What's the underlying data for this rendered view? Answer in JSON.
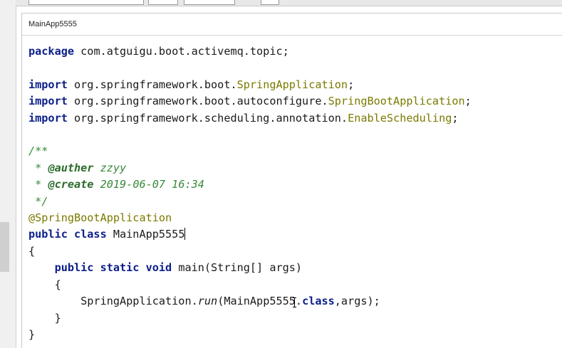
{
  "tab": {
    "title": "MainApp5555"
  },
  "code": {
    "package_kw": "package",
    "package_name": " com.atguigu.boot.activemq.topic;",
    "imports": [
      {
        "kw": "import",
        "path": " org.springframework.boot.",
        "cls": "SpringApplication",
        "end": ";"
      },
      {
        "kw": "import",
        "path": " org.springframework.boot.autoconfigure.",
        "cls": "SpringBootApplication",
        "end": ";"
      },
      {
        "kw": "import",
        "path": " org.springframework.scheduling.annotation.",
        "cls": "EnableScheduling",
        "end": ";"
      }
    ],
    "comment_open": "/**",
    "comment_star": " * ",
    "auther_tag": "@auther",
    "auther_value": " zzyy",
    "create_tag": "@create",
    "create_value": " 2019-06-07 16:34",
    "comment_close": " */",
    "annotation": "@SpringBootApplication",
    "class_kw": "public class",
    "class_name": " MainApp5555",
    "open_brace": "{",
    "method_indent": "    ",
    "method_kw": "public static void",
    "method_sig": " main(String[] args)",
    "inner_open": "    {",
    "stmt_indent": "        ",
    "stmt_cls": "SpringApplication.",
    "stmt_method": "run",
    "stmt_args_start": "(MainApp5555.",
    "stmt_kw": "class",
    "stmt_args_end": ",args);",
    "inner_close": "    }",
    "close_brace": "}"
  }
}
